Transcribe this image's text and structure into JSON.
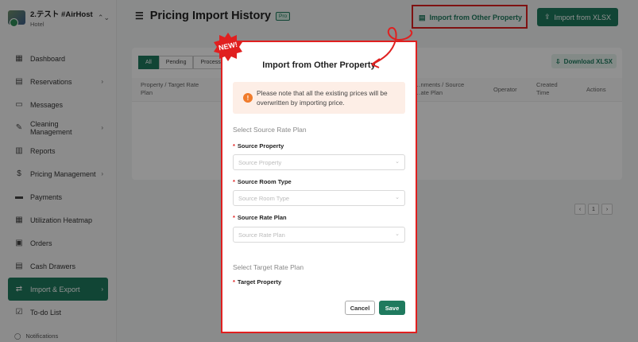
{
  "property": {
    "name": "2.テスト #AirHost",
    "type": "Hotel"
  },
  "sidebar": {
    "items": [
      {
        "label": "Dashboard",
        "icon": "dashboard-icon",
        "glyph": "▦",
        "chevron": false,
        "active": false
      },
      {
        "label": "Reservations",
        "icon": "reservations-icon",
        "glyph": "▤",
        "chevron": true,
        "active": false
      },
      {
        "label": "Messages",
        "icon": "messages-icon",
        "glyph": "▭",
        "chevron": false,
        "active": false
      },
      {
        "label": "Cleaning Management",
        "icon": "cleaning-icon",
        "glyph": "✎",
        "chevron": true,
        "active": false
      },
      {
        "label": "Reports",
        "icon": "reports-icon",
        "glyph": "▥",
        "chevron": false,
        "active": false
      },
      {
        "label": "Pricing Management",
        "icon": "pricing-icon",
        "glyph": "$",
        "chevron": true,
        "active": false
      },
      {
        "label": "Payments",
        "icon": "payments-icon",
        "glyph": "▬",
        "chevron": false,
        "active": false
      },
      {
        "label": "Utilization Heatmap",
        "icon": "heatmap-icon",
        "glyph": "▦",
        "chevron": false,
        "active": false
      },
      {
        "label": "Orders",
        "icon": "orders-icon",
        "glyph": "▣",
        "chevron": false,
        "active": false
      },
      {
        "label": "Cash Drawers",
        "icon": "cash-drawers-icon",
        "glyph": "▤",
        "chevron": false,
        "active": false
      },
      {
        "label": "Import & Export",
        "icon": "import-export-icon",
        "glyph": "⇄",
        "chevron": true,
        "active": true
      },
      {
        "label": "To-do List",
        "icon": "todo-icon",
        "glyph": "☑",
        "chevron": false,
        "active": false
      }
    ],
    "notifications": "Notifications"
  },
  "header": {
    "title": "Pricing Import History",
    "pro_badge": "Pro",
    "import_other_label": "Import from Other Property",
    "import_xlsx_label": "Import from XLSX"
  },
  "content": {
    "tabs": [
      "All",
      "Pending",
      "Processing"
    ],
    "download_label": "Download XLSX",
    "columns": [
      "Property / Target Rate Plan",
      "…nments / Source …ate Plan",
      "Operator",
      "Created Time",
      "Actions"
    ],
    "pager_current": "1"
  },
  "badge": {
    "text": "NEW!"
  },
  "modal": {
    "title": "Import from Other Property",
    "alert": "Please note that all the existing prices will be overwritten by importing price.",
    "source_section": "Select Source Rate Plan",
    "source_property_label": "Source Property",
    "source_property_placeholder": "Source Property",
    "source_room_label": "Source Room Type",
    "source_room_placeholder": "Source Room Type",
    "source_rate_label": "Source Rate Plan",
    "source_rate_placeholder": "Source Rate Plan",
    "target_section": "Select Target Rate Plan",
    "target_property_label": "Target Property",
    "cancel_label": "Cancel",
    "save_label": "Save"
  },
  "colors": {
    "accent": "#1f7a5e",
    "highlight": "#e02020",
    "alert_bg": "#fdeee6",
    "alert_icon": "#f07b2b"
  }
}
